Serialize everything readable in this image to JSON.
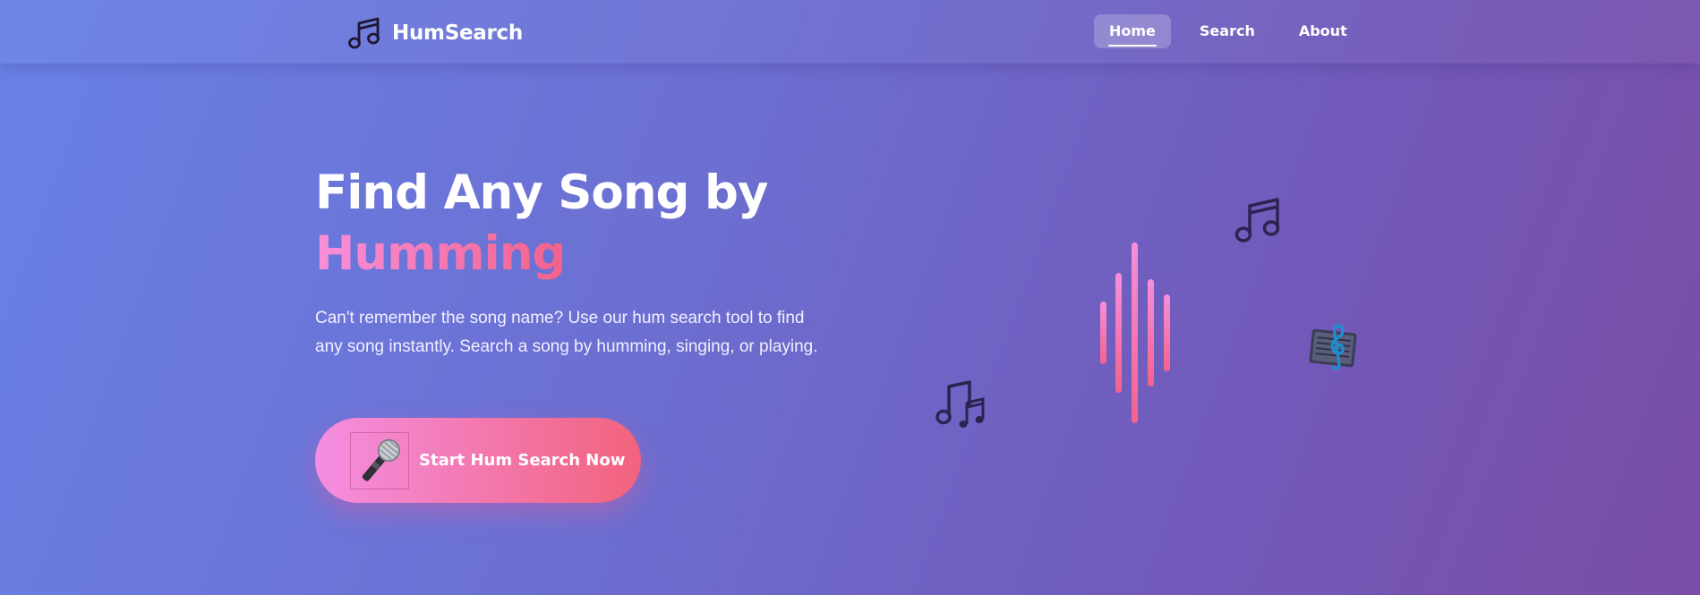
{
  "header": {
    "brand_name": "HumSearch",
    "brand_icon": "music-note-icon",
    "nav": [
      {
        "label": "Home",
        "active": true
      },
      {
        "label": "Search",
        "active": false
      },
      {
        "label": "About",
        "active": false
      }
    ]
  },
  "hero": {
    "title_line1": "Find Any Song by",
    "title_accent": "Humming",
    "description": "Can't remember the song name? Use our hum search tool to find any song instantly. Search a song by humming, singing, or playing.",
    "cta": {
      "label": "Start Hum Search Now",
      "icon": "microphone-icon"
    }
  },
  "decorations": {
    "icons": [
      "music-note-icon",
      "musical-notes-icon",
      "musical-score-icon",
      "sound-wave-icon"
    ]
  },
  "colors": {
    "background_start": "#6a80e6",
    "background_end": "#7a4ea6",
    "accent_start": "#f78fdc",
    "accent_end": "#f3628a"
  }
}
